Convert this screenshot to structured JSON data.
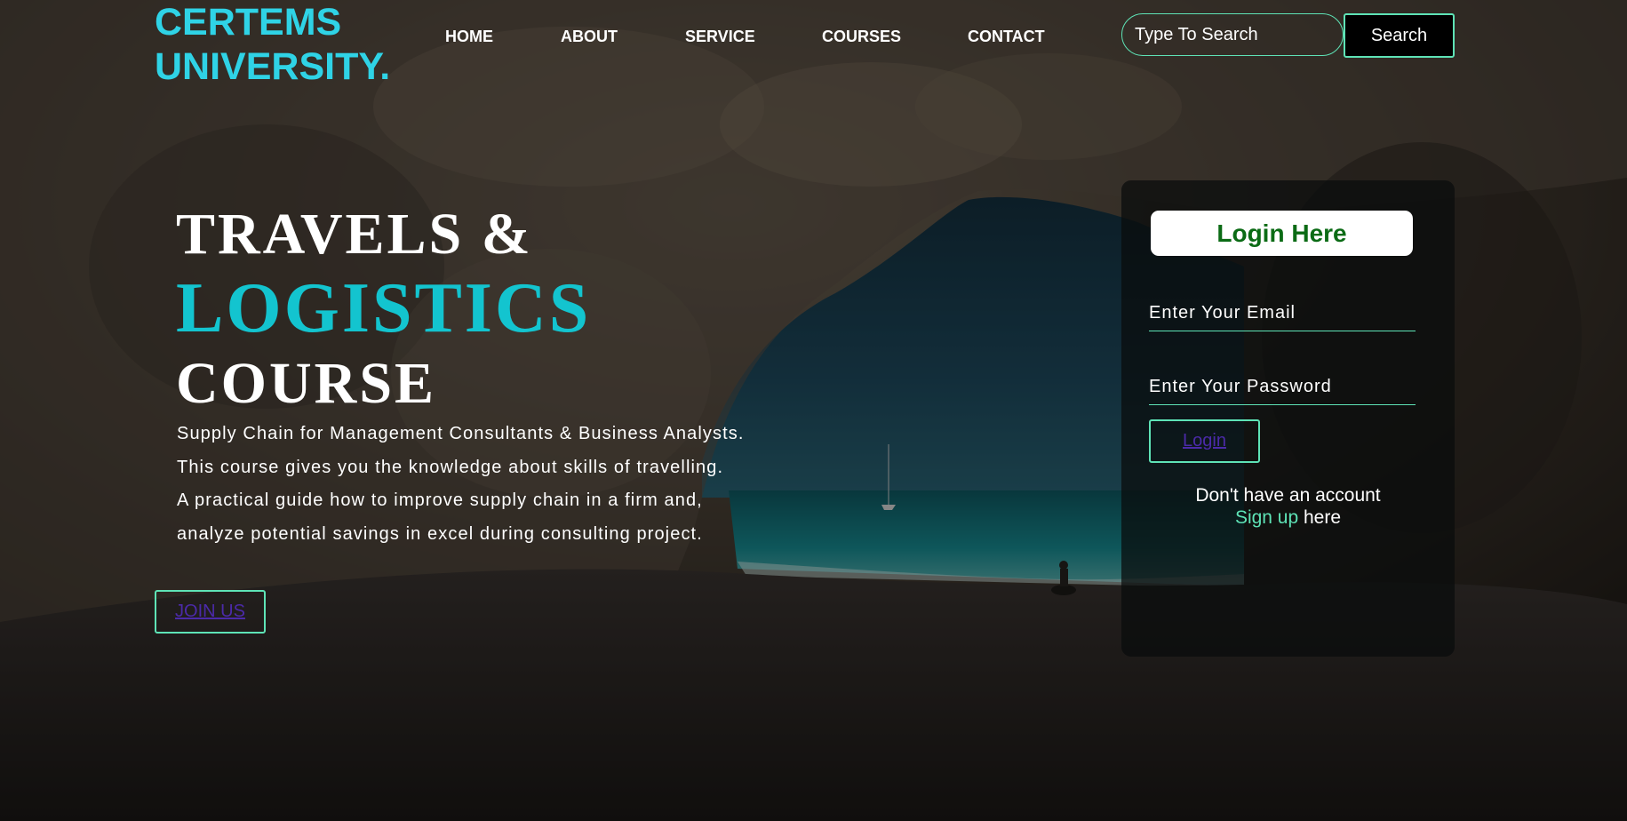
{
  "header": {
    "logo_line1": "CERTEMS",
    "logo_line2": "UNIVERSITY.",
    "nav": [
      {
        "label": "HOME"
      },
      {
        "label": "ABOUT"
      },
      {
        "label": "SERVICE"
      },
      {
        "label": "COURSES"
      },
      {
        "label": "CONTACT"
      }
    ],
    "search": {
      "placeholder": "Type To Search",
      "button_label": "Search"
    }
  },
  "hero": {
    "line1": "TRAVELS &",
    "line2": "LOGISTICS",
    "line3": "COURSE",
    "description": [
      "Supply Chain for Management Consultants & Business Analysts.",
      "This course gives you the knowledge about skills of travelling.",
      "A practical guide how to improve supply chain in a firm and,",
      "analyze potential savings in excel during consulting project."
    ],
    "join_label": "JOIN US"
  },
  "login": {
    "heading": "Login Here",
    "email_placeholder": "Enter Your Email",
    "password_placeholder": "Enter Your Password",
    "button_label": "Login",
    "no_account_text": "Don't have an account",
    "signup_link": "Sign up",
    "signup_suffix": " here"
  },
  "colors": {
    "logo": "#2fd3e6",
    "accent_teal": "#13c4cf",
    "border_green": "#5ee3b6",
    "link_purple": "#4b2aa8",
    "heading_green": "#0b6b15"
  }
}
